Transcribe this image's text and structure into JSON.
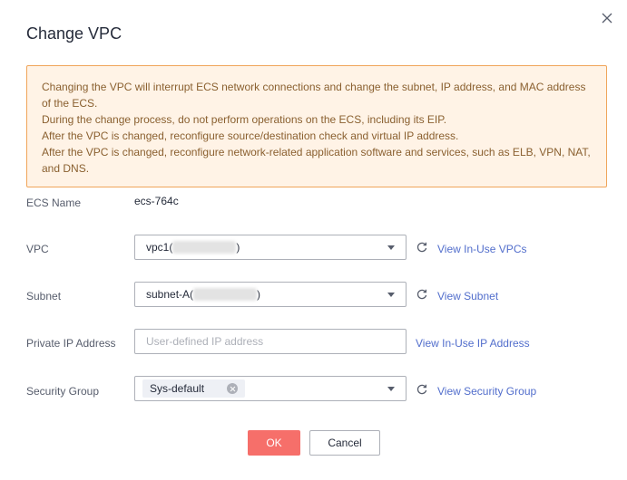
{
  "dialog": {
    "title": "Change VPC",
    "close_icon": "close-icon"
  },
  "alert": {
    "lines": [
      "Changing the VPC will interrupt ECS network connections and change the subnet, IP address, and MAC address of the ECS.",
      "During the change process, do not perform operations on the ECS, including its EIP.",
      "After the VPC is changed, reconfigure source/destination check and virtual IP address.",
      "After the VPC is changed, reconfigure network-related application software and services, such as ELB, VPN, NAT, and DNS."
    ],
    "colors": {
      "background": "#fff3e6",
      "border": "#f0a55a"
    }
  },
  "form": {
    "ecs_name": {
      "label": "ECS Name",
      "value": "ecs-764c"
    },
    "vpc": {
      "label": "VPC",
      "selected_prefix": "vpc1(",
      "selected_suffix": ")",
      "link": "View In-Use VPCs",
      "refresh_icon": "refresh-icon"
    },
    "subnet": {
      "label": "Subnet",
      "selected_prefix": "subnet-A(",
      "selected_suffix": ")",
      "link": "View Subnet",
      "refresh_icon": "refresh-icon"
    },
    "private_ip": {
      "label": "Private IP Address",
      "value": "",
      "placeholder": "User-defined IP address",
      "link": "View In-Use IP Address"
    },
    "security_group": {
      "label": "Security Group",
      "tags": [
        "Sys-default"
      ],
      "link": "View Security Group",
      "refresh_icon": "refresh-icon"
    }
  },
  "buttons": {
    "ok": "OK",
    "cancel": "Cancel"
  },
  "colors": {
    "primary": "#f66f6a",
    "link": "#526ecc",
    "text": "#252b3a",
    "label": "#575d6c"
  }
}
